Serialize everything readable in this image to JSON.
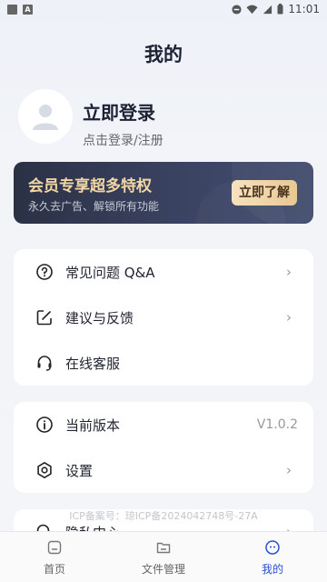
{
  "status_bar": {
    "time": "11:01"
  },
  "header": {
    "title": "我的"
  },
  "profile": {
    "title": "立即登录",
    "subtitle": "点击登录/注册"
  },
  "vip": {
    "title": "会员专享超多特权",
    "subtitle": "永久去广告、解锁所有功能",
    "button": "立即了解"
  },
  "menu_group_1": [
    {
      "label": "常见问题 Q&A",
      "icon": "question-circle-icon",
      "chevron": "›"
    },
    {
      "label": "建议与反馈",
      "icon": "edit-icon",
      "chevron": "›"
    },
    {
      "label": "在线客服",
      "icon": "headset-icon"
    }
  ],
  "menu_group_2": [
    {
      "label": "当前版本",
      "icon": "info-icon",
      "value": "V1.0.2"
    },
    {
      "label": "设置",
      "icon": "gear-icon",
      "chevron": "›"
    }
  ],
  "menu_group_3": [
    {
      "label": "隐私中心",
      "icon": "search-icon",
      "chevron": "›"
    }
  ],
  "icp": "ICP备案号：琼ICP备2024042748号-27A",
  "bottom_nav": [
    {
      "label": "首页",
      "icon": "home-icon",
      "active": false
    },
    {
      "label": "文件管理",
      "icon": "folder-icon",
      "active": false
    },
    {
      "label": "我的",
      "icon": "profile-icon",
      "active": true
    }
  ],
  "colors": {
    "accent": "#2a4fd6",
    "vip_bg": "#2b3145",
    "vip_gold": "#f1d7a6"
  }
}
